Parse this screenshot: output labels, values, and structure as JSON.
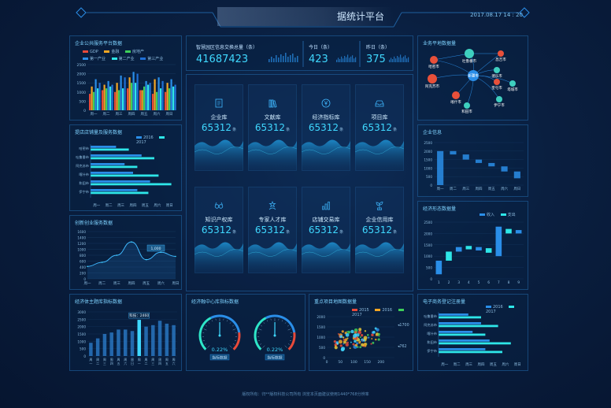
{
  "header": {
    "title": "据统计平台",
    "datetime": "2017.08.17  14 : 20"
  },
  "panels": {
    "enterprise": {
      "title": "企业公共服务平台数据"
    },
    "stores": {
      "title": "提店店铺量及服务数据"
    },
    "innovation": {
      "title": "创新创业服务数据"
    },
    "theme": {
      "title": "经济体主题库指标数据"
    },
    "center": {
      "title": "经济融中心库指标数据"
    },
    "projects": {
      "title": "重点项目地图数据量"
    },
    "biz_map": {
      "title": "业务平地数据量"
    },
    "company_info": {
      "title": "企业信息"
    },
    "economy": {
      "title": "经济形态数据量"
    },
    "ecommerce": {
      "title": "电子商务登记注册量"
    }
  },
  "stats": [
    {
      "label": "智慧园区信息交换总量（条）",
      "value": "41687423"
    },
    {
      "label": "今日（条）",
      "value": "423"
    },
    {
      "label": "昨日（条）",
      "value": "375"
    }
  ],
  "cards": [
    {
      "label": "企业库",
      "value": "65312",
      "unit": "条",
      "icon": "document-icon"
    },
    {
      "label": "文献库",
      "value": "65312",
      "unit": "条",
      "icon": "books-icon"
    },
    {
      "label": "经济指标库",
      "value": "65312",
      "unit": "条",
      "icon": "yen-coin-icon"
    },
    {
      "label": "项目库",
      "value": "65312",
      "unit": "条",
      "icon": "inbox-icon"
    },
    {
      "label": "知识产权库",
      "value": "65312",
      "unit": "条",
      "icon": "glasses-icon"
    },
    {
      "label": "专家人才库",
      "value": "65312",
      "unit": "条",
      "icon": "star-person-icon"
    },
    {
      "label": "店铺交易库",
      "value": "65312",
      "unit": "条",
      "icon": "bar-chart-icon"
    },
    {
      "label": "企业信用库",
      "value": "65312",
      "unit": "条",
      "icon": "sprout-icon"
    }
  ],
  "gauges": [
    {
      "value_label": "0.22%",
      "value": 0.22,
      "caption": "指标数据"
    },
    {
      "value_label": "0.22%",
      "value": 0.22,
      "caption": "指标数据"
    }
  ],
  "footer": {
    "text": "版权所有：归**版权科技公司所有    浏览本页面建议使用1440*768分辨率"
  },
  "colors": {
    "accent": "#3fd8ff",
    "bar_blue": "#2a8ee8",
    "bar_cyan": "#2ee6e8",
    "orange": "#f5a623",
    "red": "#e84a3a",
    "green": "#3ecf5a"
  },
  "chart_data": [
    {
      "type": "bar",
      "title": "企业公共服务平台数据",
      "categories": [
        "周一",
        "周二",
        "周三",
        "周四",
        "周五",
        "周六",
        "周日"
      ],
      "ylim": [
        0,
        2500
      ],
      "yticks": [
        0,
        500,
        1000,
        1500,
        2000,
        2500
      ],
      "series": [
        {
          "name": "GDP",
          "color": "#e84a3a",
          "values": [
            900,
            1100,
            1000,
            1200,
            1100,
            900,
            1000
          ]
        },
        {
          "name": "金融",
          "color": "#f5a623",
          "values": [
            1300,
            1400,
            1500,
            1800,
            1100,
            1700,
            1500
          ]
        },
        {
          "name": "房地产",
          "color": "#3ecf5a",
          "values": [
            1000,
            1200,
            1100,
            1500,
            1300,
            1000,
            1200
          ]
        },
        {
          "name": "第一产业",
          "color": "#2a8ee8",
          "values": [
            1700,
            1600,
            1900,
            2100,
            1600,
            1800,
            1700
          ]
        },
        {
          "name": "第二产业",
          "color": "#2ee6e8",
          "values": [
            1200,
            1300,
            1200,
            1500,
            1400,
            1200,
            1300
          ]
        },
        {
          "name": "第三产业",
          "color": "#1f6fd6",
          "values": [
            1500,
            1400,
            1800,
            2000,
            1500,
            1600,
            1400
          ]
        }
      ]
    },
    {
      "type": "bar",
      "title": "提店店铺量及服务数据",
      "categories": [
        "哈密市",
        "吐鲁番市",
        "阿克苏市",
        "喀什市",
        "和田市",
        "伊宁市"
      ],
      "xticks": [
        "周一",
        "周二",
        "周三",
        "周四",
        "周五",
        "周六",
        "周日"
      ],
      "series": [
        {
          "name": "2016",
          "color": "#2a8ee8",
          "values": [
            30,
            60,
            40,
            50,
            70,
            55
          ]
        },
        {
          "name": "2017",
          "color": "#2ee6e8",
          "values": [
            45,
            75,
            55,
            80,
            95,
            68
          ]
        }
      ]
    },
    {
      "type": "line",
      "title": "创新创业服务数据",
      "categories": [
        "周一",
        "周二",
        "周三",
        "周四",
        "周五",
        "周六",
        "周日"
      ],
      "ylim": [
        0,
        1600
      ],
      "yticks": [
        0,
        200,
        400,
        600,
        800,
        1000,
        1200,
        1400,
        1600
      ],
      "values": [
        420,
        560,
        800,
        1250,
        650,
        900,
        760
      ],
      "tooltip": "1,000"
    },
    {
      "type": "bar",
      "title": "经济体主题库指标数据",
      "categories": [
        "周",
        "周",
        "周",
        "周",
        "周",
        "周",
        "周",
        "周",
        "周",
        "周",
        "周",
        "周",
        "周"
      ],
      "subcategories": [
        "一",
        "二",
        "三",
        "四",
        "五",
        "六",
        "日",
        "一",
        "二",
        "三",
        "四",
        "五",
        "六"
      ],
      "ylim": [
        0,
        3000
      ],
      "yticks": [
        0,
        500,
        1000,
        1500,
        2000,
        2500,
        3000
      ],
      "values": [
        900,
        1200,
        1500,
        1600,
        1800,
        1800,
        1700,
        2460,
        2000,
        2100,
        2400,
        2200,
        2100
      ],
      "highlight": {
        "index": 7,
        "label": "科技：2460"
      }
    },
    {
      "type": "scatter",
      "title": "重点项目地图数据量",
      "xlim": [
        0,
        250
      ],
      "ylim": [
        0,
        2000
      ],
      "xticks": [
        0,
        50,
        100,
        150,
        200
      ],
      "yticks": [
        0,
        500,
        1000,
        1500,
        2000
      ],
      "series": [
        {
          "name": "2015",
          "color": "#e84a3a"
        },
        {
          "name": "2016",
          "color": "#f5a623"
        },
        {
          "name": "2017",
          "color": "#3ecf5a"
        }
      ],
      "annotations": [
        "1700",
        "762"
      ]
    },
    {
      "type": "bar",
      "title": "企业信息",
      "categories": [
        "周一",
        "周二",
        "周三",
        "周四",
        "周五",
        "周六",
        "周日"
      ],
      "ylim": [
        0,
        2500
      ],
      "yticks": [
        0,
        500,
        1000,
        1500,
        2000,
        2500
      ],
      "values": [
        2000,
        1800,
        1500,
        1300,
        1100,
        800,
        400
      ]
    },
    {
      "type": "bar",
      "title": "经济形态数据量",
      "categories": [
        "1",
        "2",
        "3",
        "4",
        "5",
        "6",
        "7",
        "8",
        "9"
      ],
      "ylim": [
        0,
        2500
      ],
      "yticks": [
        0,
        500,
        1000,
        1500,
        2000,
        2500
      ],
      "series": [
        {
          "name": "收入",
          "color": "#2a8ee8"
        },
        {
          "name": "支出",
          "color": "#2ee6e8"
        }
      ],
      "waterfall": [
        [
          200,
          800
        ],
        [
          800,
          1200
        ],
        [
          1200,
          1400
        ],
        [
          1300,
          1450
        ],
        [
          1250,
          1400
        ],
        [
          1150,
          1350
        ],
        [
          1000,
          2300
        ],
        [
          2000,
          2200
        ],
        [
          2000,
          2150
        ]
      ]
    },
    {
      "type": "bar",
      "title": "电子商务登记注册量",
      "categories": [
        "吐鲁番市",
        "阿克苏市",
        "喀什市",
        "和田市",
        "伊宁市"
      ],
      "xticks": [
        "周一",
        "周二",
        "周三",
        "周四",
        "周五",
        "周六",
        "周日"
      ],
      "series": [
        {
          "name": "2016",
          "color": "#2a8ee8",
          "values": [
            35,
            50,
            40,
            60,
            55
          ]
        },
        {
          "name": "2017",
          "color": "#2ee6e8",
          "values": [
            50,
            70,
            55,
            85,
            75
          ]
        }
      ]
    }
  ],
  "graph": {
    "nodes": [
      {
        "label": "吐鲁番市",
        "color": "#3ecfbf"
      },
      {
        "label": "哈密市",
        "color": "#e8503a"
      },
      {
        "label": "昌吉市",
        "color": "#e8503a"
      },
      {
        "label": "博乐市",
        "color": "#3ecfbf"
      },
      {
        "label": "新疆市",
        "color": "#2a8ee8"
      },
      {
        "label": "阿克苏市",
        "color": "#e8503a"
      },
      {
        "label": "奎屯市",
        "color": "#e8503a"
      },
      {
        "label": "塔城市",
        "color": "#3ecfbf"
      },
      {
        "label": "喀什市",
        "color": "#e8503a"
      },
      {
        "label": "伊宁市",
        "color": "#3ecfbf"
      },
      {
        "label": "和田市",
        "color": "#3ecfbf"
      }
    ]
  }
}
